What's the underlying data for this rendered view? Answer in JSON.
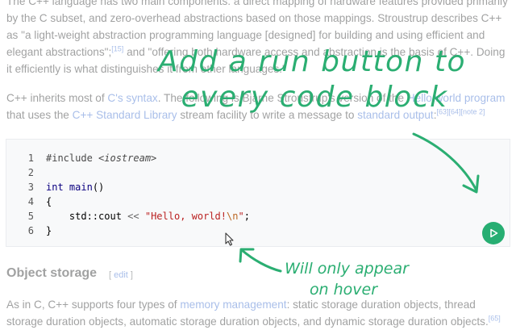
{
  "article": {
    "p1": {
      "t1": "The C++ language has two main components: a direct mapping of hardware features provided primarily by the C subset, and zero-overhead abstractions based on those mappings. Stroustrup describes C++ as \"a light-weight abstraction programming language [designed] for building and using efficient and elegant abstractions\";",
      "ref1": "[15]",
      "t2": " and \"offering both hardware access and abstraction is the basis of C++. Doing it efficiently is what distinguishes it from other languages.\""
    },
    "p2": {
      "t1": "C++ inherits most of ",
      "link1": "C's syntax",
      "t2": ". The following is Bjarne Stroustrup's version of the ",
      "link2": "Hello world program",
      "t3": " that uses the ",
      "link3": "C++ Standard Library",
      "t4": " stream facility to write a message to ",
      "link4": "standard output",
      "t5": ":",
      "refs": "[63][64][note 2]"
    },
    "p3": {
      "t1": "As in C, C++ supports four types of ",
      "link1": "memory management",
      "t2": ": static storage duration objects, thread storage duration objects, automatic storage duration objects, and dynamic storage duration objects.",
      "ref1": "[65]"
    },
    "section_heading": "Object storage",
    "edit_open": "[ ",
    "edit_label": "edit",
    "edit_close": " ]"
  },
  "code": {
    "line_numbers": [
      "1",
      "2",
      "3",
      "4",
      "5",
      "6"
    ],
    "include_directive": "#include",
    "include_header": "<iostream>",
    "kw_int": "int",
    "fn_main": "main",
    "parens": "()",
    "brace_open": "{",
    "cout": "std::cout",
    "op_shift": "<<",
    "str_open": "\"Hello, world!",
    "str_escape": "\\n",
    "str_close": "\"",
    "semicolon": ";",
    "brace_close": "}"
  },
  "run_button": {
    "icon": "play-icon"
  },
  "annotations": {
    "main_line1": "Add a run button to",
    "main_line2": "every code block",
    "sub_line1": "Will only appear",
    "sub_line2": "on hover"
  },
  "colors": {
    "accent_green": "#27ae72",
    "annotation_green": "#2bae72",
    "link_blue": "#3366cc",
    "code_background": "#f8f9fa"
  }
}
